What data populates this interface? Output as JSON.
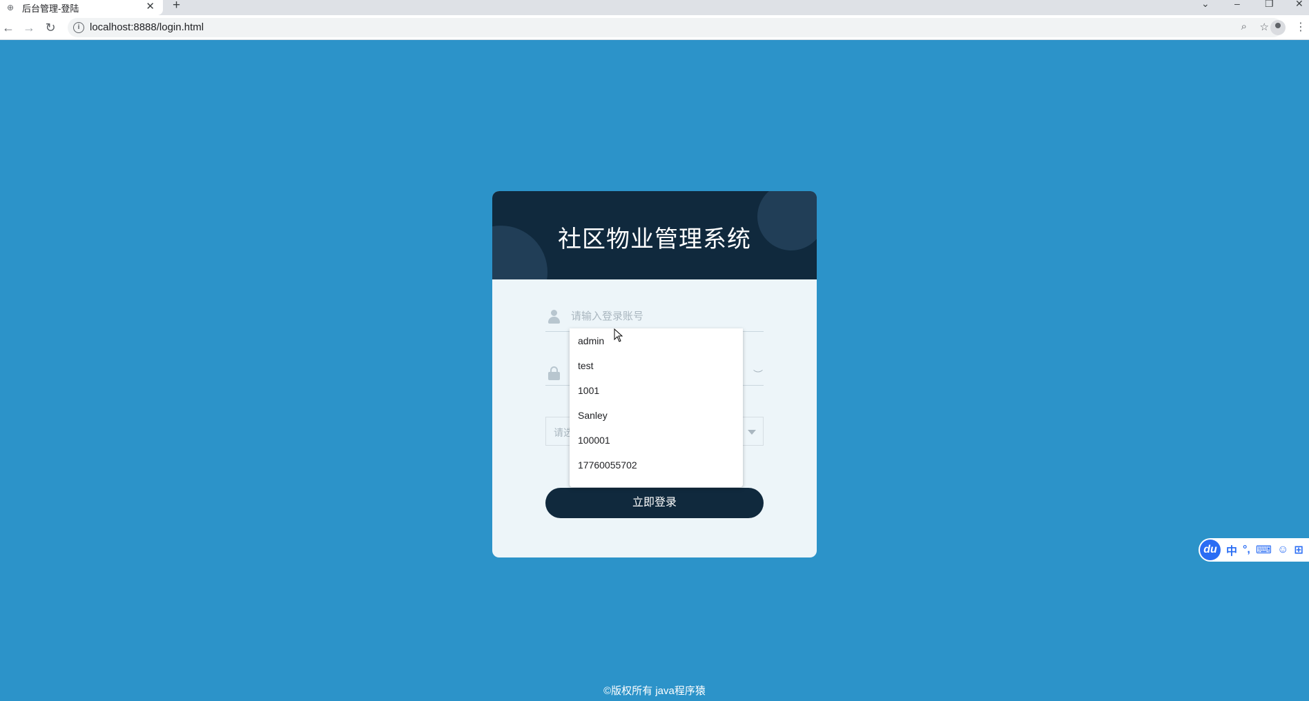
{
  "browser": {
    "tab_title": "后台管理-登陆",
    "tab_close": "✕",
    "new_tab": "+",
    "url": "localhost:8888/login.html",
    "back": "←",
    "forward": "→",
    "reload": "↻",
    "info": "i",
    "zoom_icon": "⌕",
    "star_icon": "☆",
    "menu_icon": "⋮"
  },
  "card": {
    "title": "社区物业管理系统",
    "username_placeholder": "请输入登录账号",
    "password_placeholder": "",
    "eye_glyph": "︶",
    "select_placeholder": "请选",
    "login_label": "立即登录"
  },
  "autocomplete": {
    "items": [
      "admin",
      "test",
      "1001",
      "Sanley",
      "100001",
      "17760055702"
    ]
  },
  "ime": {
    "logo": "du",
    "items": [
      "中",
      "°,",
      "⌨",
      "☺",
      "⊞"
    ]
  },
  "footer": "©版权所有 java程序猿",
  "colors": {
    "background": "#2c93c9",
    "header": "#10293d",
    "card": "#edf5f9",
    "accent": "#2a6df4"
  }
}
